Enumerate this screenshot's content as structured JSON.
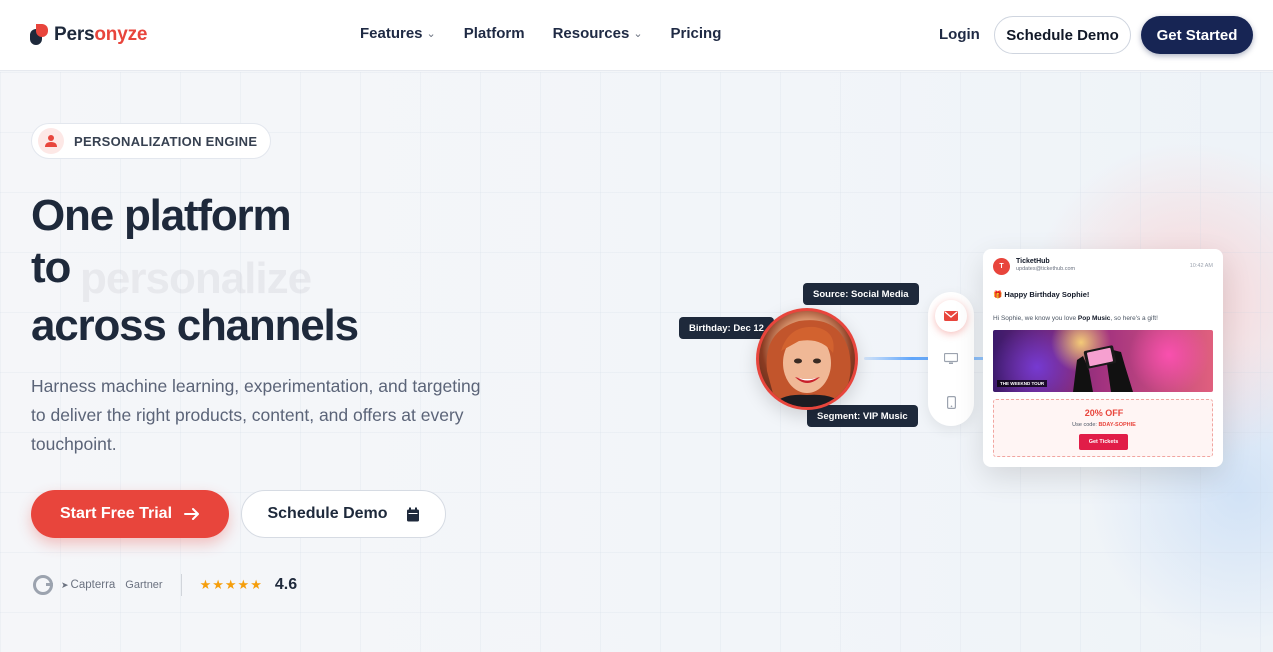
{
  "brand": {
    "name_dark": "Pers",
    "name_accent": "onyze"
  },
  "nav": {
    "links": [
      {
        "label": "Features",
        "has_dropdown": true
      },
      {
        "label": "Platform",
        "has_dropdown": false
      },
      {
        "label": "Resources",
        "has_dropdown": true
      },
      {
        "label": "Pricing",
        "has_dropdown": false
      }
    ],
    "login": "Login",
    "schedule_demo": "Schedule Demo",
    "get_started": "Get Started"
  },
  "hero": {
    "badge": "PERSONALIZATION ENGINE",
    "headline": [
      "One platform",
      "to",
      "across channels"
    ],
    "headline_ghost_word": "personalize",
    "subtext": "Harness machine learning, experimentation, and targeting to deliver the right products, content, and offers at every touchpoint.",
    "cta_primary": "Start Free Trial",
    "cta_secondary": "Schedule Demo",
    "ratings": {
      "sources": [
        "Capterra",
        "Gartner"
      ],
      "stars": "★★★★★",
      "score": "4.6"
    }
  },
  "illustration": {
    "tags": {
      "source": "Source: Social Media",
      "birthday": "Birthday: Dec 12",
      "segment": "Segment: VIP Music"
    },
    "channels": [
      "email-icon",
      "desktop-icon",
      "mobile-icon"
    ],
    "email": {
      "avatar_letter": "T",
      "from": "TicketHub",
      "address": "updates@tickethub.com",
      "time": "10:42 AM",
      "subject": "🎁 Happy Birthday Sophie!",
      "body_prefix": "Hi Sophie, we know you love ",
      "body_bold": "Pop Music",
      "body_suffix": ", so here's a gift!",
      "image_label": "THE WEEKND TOUR",
      "offer_title": "20% OFF",
      "offer_code_prefix": "Use code: ",
      "offer_code": "BDAY-SOPHIE",
      "offer_button": "Get Tickets"
    }
  },
  "colors": {
    "accent": "#e8453c",
    "navy": "#172554",
    "text": "#1e293b"
  }
}
